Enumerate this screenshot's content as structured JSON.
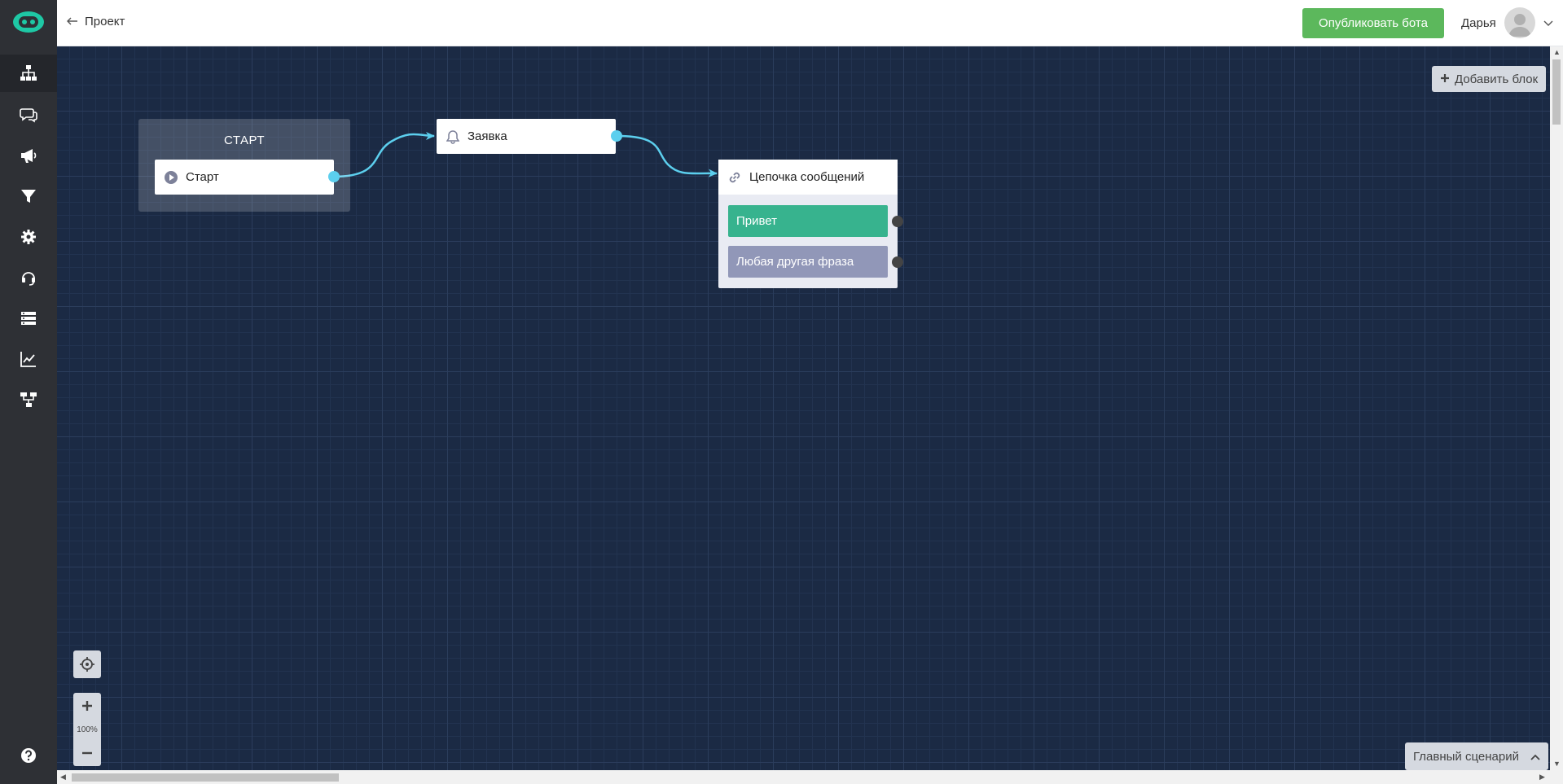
{
  "header": {
    "back_label": "Проект",
    "publish_label": "Опубликовать бота",
    "user_name": "Дарья"
  },
  "sidebar": {
    "items": [
      {
        "icon": "sitemap-icon",
        "active": true
      },
      {
        "icon": "chat-icon"
      },
      {
        "icon": "megaphone-icon"
      },
      {
        "icon": "filter-icon"
      },
      {
        "icon": "gear-icon"
      },
      {
        "icon": "headset-icon"
      },
      {
        "icon": "server-icon"
      },
      {
        "icon": "chart-line-icon"
      },
      {
        "icon": "hierarchy-icon"
      }
    ],
    "help_icon": "question-icon"
  },
  "canvas": {
    "add_block_label": "Добавить блок",
    "start_group_title": "СТАРТ",
    "nodes": {
      "start": {
        "label": "Старт",
        "icon": "play-icon"
      },
      "request": {
        "label": "Заявка",
        "icon": "bell-icon"
      },
      "chain": {
        "label": "Цепочка сообщений",
        "icon": "link-icon",
        "buttons": [
          "Привет",
          "Любая другая фраза"
        ]
      }
    },
    "zoom_label": "100%",
    "scenario_label": "Главный сценарий"
  },
  "colors": {
    "canvas_bg": "#1b2a44",
    "sidebar_bg": "#2e3035",
    "publish_green": "#5cb85c",
    "connector_cyan": "#5ccfee",
    "button_green": "#37b38e",
    "button_grey": "#9197b8",
    "logo_teal": "#1ec8a5"
  }
}
